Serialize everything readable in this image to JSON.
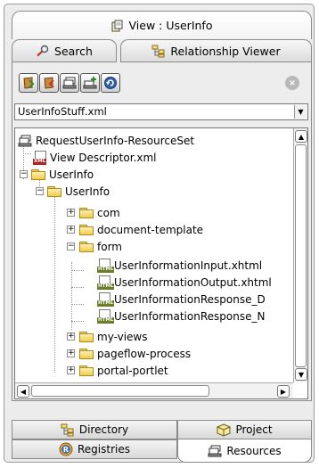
{
  "header": {
    "title": "View : UserInfo",
    "title_icon": "view-icon"
  },
  "tabs": {
    "search": {
      "label": "Search",
      "icon": "magnifier-icon"
    },
    "relationship": {
      "label": "Relationship Viewer",
      "icon": "relationship-icon"
    }
  },
  "toolbar": {
    "buttons": [
      "add-file-icon",
      "remove-file-icon",
      "stack-icon",
      "add-stack-icon",
      "refresh-icon"
    ],
    "stop_icon": "stop-icon"
  },
  "selector": {
    "value": "UserInfoStuff.xml"
  },
  "tree": {
    "items": [
      {
        "label": "RequestUserInfo-ResourceSet",
        "icon": "resource-set-icon"
      },
      {
        "label": "View Descriptor.xml",
        "icon": "xml-file-icon",
        "badge": "XML"
      },
      {
        "label": "UserInfo",
        "icon": "folder-icon"
      },
      {
        "label": "UserInfo",
        "icon": "folder-icon"
      },
      {
        "label": "com",
        "icon": "folder-icon"
      },
      {
        "label": "document-template",
        "icon": "folder-icon"
      },
      {
        "label": "form",
        "icon": "folder-icon"
      },
      {
        "label": "UserInformationInput.xhtml",
        "icon": "html-file-icon",
        "badge": "HTML"
      },
      {
        "label": "UserInformationOutput.xhtml",
        "icon": "html-file-icon",
        "badge": "HTML"
      },
      {
        "label": "UserInformationResponse_D",
        "icon": "html-file-icon",
        "badge": "HTML"
      },
      {
        "label": "UserInformationResponse_N",
        "icon": "html-file-icon",
        "badge": "HTML"
      },
      {
        "label": "my-views",
        "icon": "folder-icon"
      },
      {
        "label": "pageflow-process",
        "icon": "folder-icon"
      },
      {
        "label": "portal-portlet",
        "icon": "folder-icon"
      }
    ]
  },
  "bottom_tabs": {
    "directory": "Directory",
    "project": "Project",
    "registries": "Registries",
    "resources": "Resources"
  },
  "colors": {
    "panel": "#ececec",
    "folder": "#f0cc4b",
    "html_badge": "#6b7d2a",
    "xml_badge": "#b22222",
    "registries_icon": "#3a6fc4"
  }
}
